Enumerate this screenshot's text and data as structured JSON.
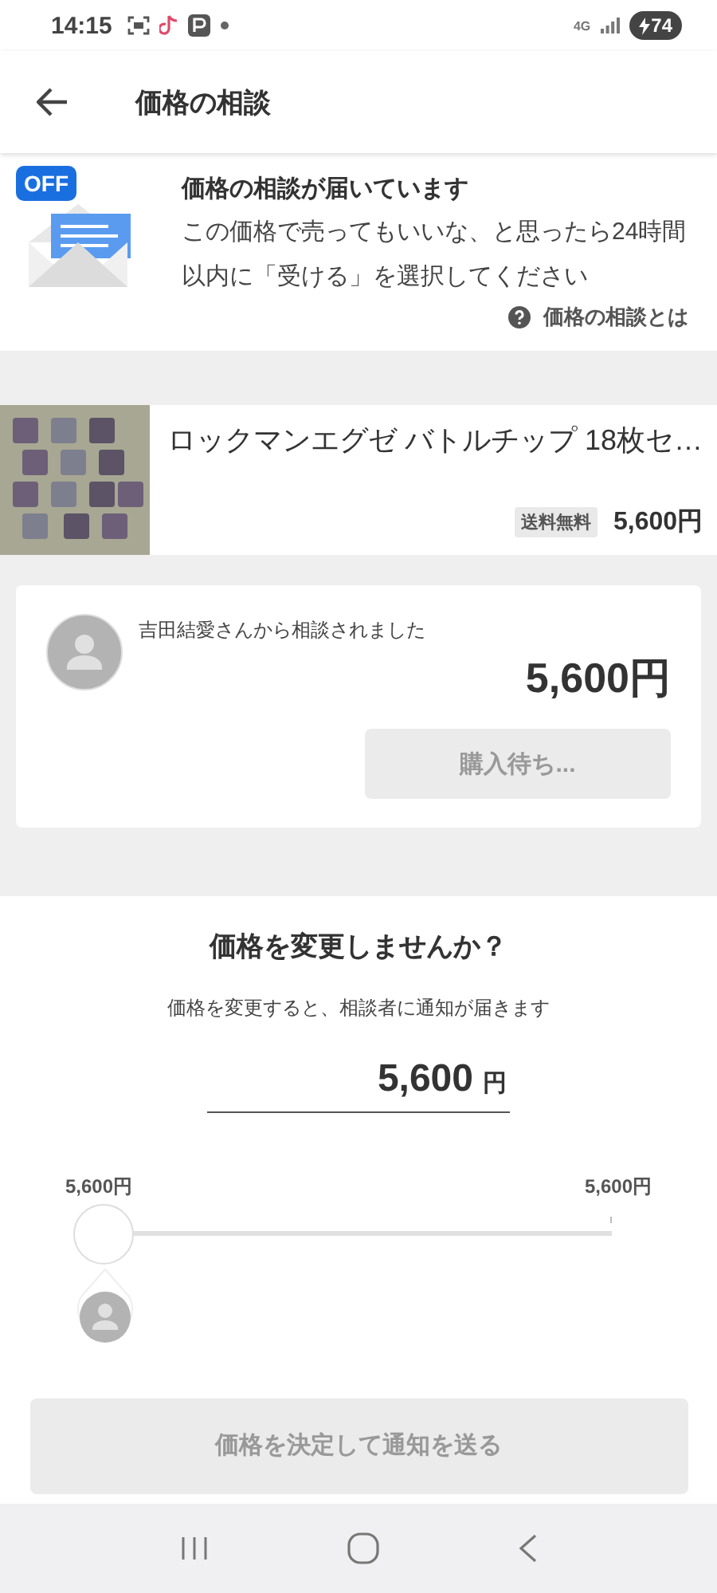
{
  "status_bar": {
    "time": "14:15",
    "network": "4G",
    "battery": "74"
  },
  "header": {
    "title": "価格の相談"
  },
  "notice": {
    "badge": "OFF",
    "title": "価格の相談が届いています",
    "body": "この価格で売ってもいいな、と思ったら24時間以内に「受ける」を選択してください",
    "help_link": "価格の相談とは"
  },
  "product": {
    "title": "ロックマンエグゼ バトルチップ 18枚セ…",
    "shipping_badge": "送料無料",
    "price": "5,600円"
  },
  "offer": {
    "message": "吉田結愛さんから相談されました",
    "price": "5,600円",
    "button": {
      "label": "購入待ち...",
      "disabled": true
    }
  },
  "price_change": {
    "title": "価格を変更しませんか？",
    "subtitle": "価格を変更すると、相談者に通知が届きます",
    "value": "5,600",
    "unit": "円",
    "slider": {
      "min_label": "5,600円",
      "max_label": "5,600円",
      "level": 0
    },
    "submit_button": {
      "label": "価格を決定して通知を送る",
      "disabled": true
    }
  }
}
